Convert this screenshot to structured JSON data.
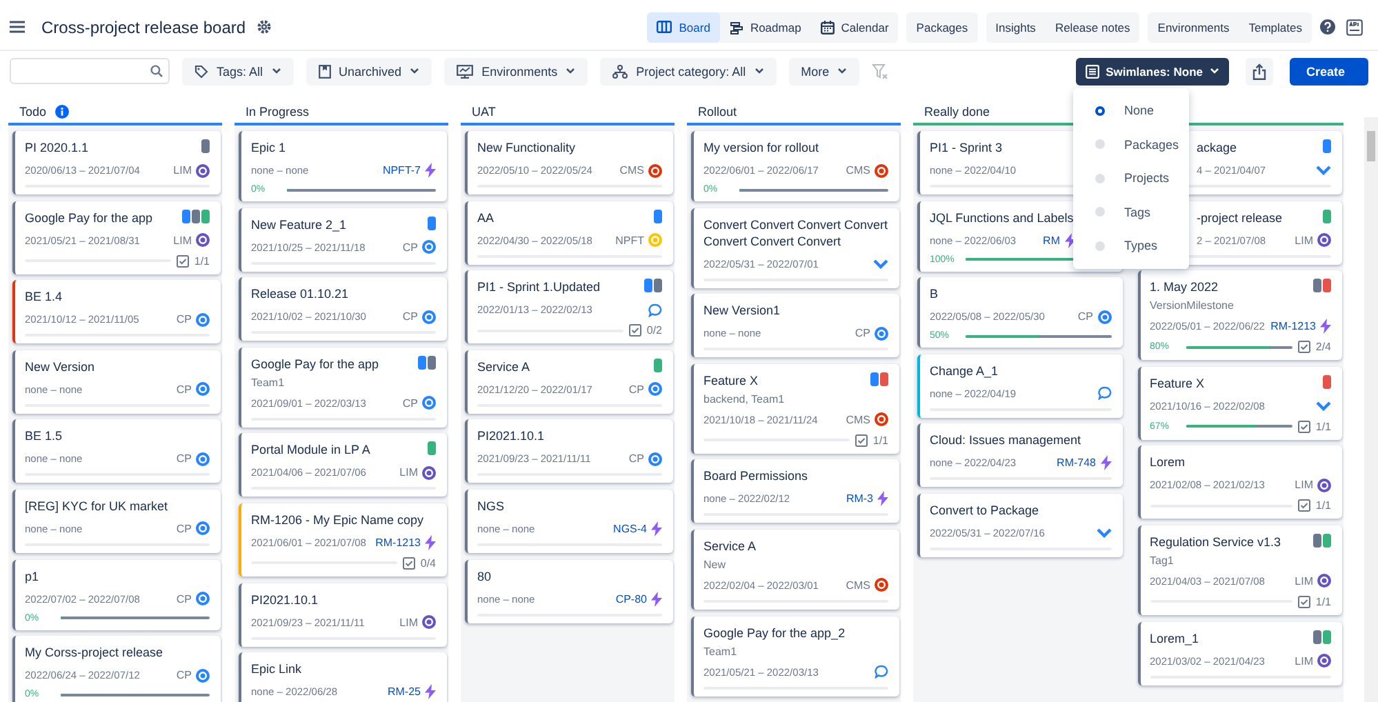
{
  "header": {
    "title": "Cross-project release board"
  },
  "nav_groups": [
    {
      "items": [
        {
          "label": "Board",
          "selected": true
        },
        {
          "label": "Roadmap",
          "selected": false
        },
        {
          "label": "Calendar",
          "selected": false
        }
      ]
    },
    {
      "items": [
        {
          "label": "Packages",
          "selected": false
        }
      ]
    },
    {
      "items": [
        {
          "label": "Insights",
          "selected": false
        },
        {
          "label": "Release notes",
          "selected": false
        }
      ]
    },
    {
      "items": [
        {
          "label": "Environments",
          "selected": false
        },
        {
          "label": "Templates",
          "selected": false
        }
      ]
    }
  ],
  "filters": [
    {
      "label": "Tags: All"
    },
    {
      "label": "Unarchived"
    },
    {
      "label": "Environments"
    },
    {
      "label": "Project category: All"
    },
    {
      "label": "More"
    }
  ],
  "swimlanes": {
    "label": "Swimlanes: None",
    "options": [
      {
        "label": "None",
        "selected": true
      },
      {
        "label": "Packages",
        "selected": false
      },
      {
        "label": "Projects",
        "selected": false
      },
      {
        "label": "Tags",
        "selected": false
      },
      {
        "label": "Types",
        "selected": false
      }
    ]
  },
  "create_button": "Create",
  "columns": [
    {
      "name": "Todo",
      "info": true,
      "color": "#2684ff",
      "lanes": [
        [
          {
            "title": "PI 2020.1.1",
            "tags": [
              {
                "color": "#6b778c"
              }
            ],
            "dates": "2020/06/13 – 2021/07/04",
            "badge": {
              "kind": "project",
              "text": "LIM",
              "color": "#6554c0"
            },
            "color": "#6b778c"
          },
          {
            "title": "Google Pay for the app",
            "tags": [
              {
                "color": "#2684ff"
              },
              {
                "color": "#6b778c"
              },
              {
                "color": "#36b37e"
              }
            ],
            "dates": "2021/05/21 – 2021/08/31",
            "badge": {
              "kind": "project",
              "text": "LIM",
              "color": "#6554c0"
            },
            "checklist": "1/1",
            "color": "#6b778c"
          },
          {
            "title": "BE 1.4",
            "dates": "2021/10/12 – 2021/11/05",
            "badge": {
              "kind": "project",
              "text": "CP",
              "color": "#2684ff"
            },
            "color": "#de350b"
          },
          {
            "title": "New Version",
            "dates": "none – none",
            "badge": {
              "kind": "project",
              "text": "CP",
              "color": "#2684ff"
            },
            "color": "#6b778c"
          },
          {
            "title": "BE 1.5",
            "dates": "none – none",
            "badge": {
              "kind": "project",
              "text": "CP",
              "color": "#2684ff"
            },
            "color": "#6b778c"
          },
          {
            "title": "[REG] KYC for UK market",
            "dates": "none – none",
            "badge": {
              "kind": "project",
              "text": "CP",
              "color": "#2684ff"
            },
            "color": "#6b778c"
          },
          {
            "title": "p1",
            "dates": "2022/07/02 – 2022/07/08",
            "badge": {
              "kind": "project",
              "text": "CP",
              "color": "#2684ff"
            },
            "progress": {
              "label": "0%",
              "level": 0
            },
            "color": "#6b778c"
          },
          {
            "title": "My Corss-project release",
            "dates": "2022/06/24 – 2022/07/12",
            "badge": {
              "kind": "project",
              "text": "CP",
              "color": "#2684ff"
            },
            "progress": {
              "label": "0%",
              "level": 0
            },
            "color": "#6b778c"
          }
        ]
      ]
    },
    {
      "name": "In Progress",
      "info": false,
      "color": "#2684ff",
      "lanes": [
        [
          {
            "title": "Epic 1",
            "dates": "none – none",
            "badge": {
              "kind": "issue",
              "text": "NPFT-7"
            },
            "progress": {
              "label": "0%",
              "level": 0
            },
            "color": "#6b778c"
          },
          {
            "title": "New Feature 2_1",
            "tags": [
              {
                "color": "#2684ff"
              }
            ],
            "dates": "2021/10/25 – 2021/11/18",
            "badge": {
              "kind": "project",
              "text": "CP",
              "color": "#2684ff"
            },
            "color": "#6b778c"
          },
          {
            "title": "Release 01.10.21",
            "dates": "2021/10/02 – 2021/10/30",
            "badge": {
              "kind": "project",
              "text": "CP",
              "color": "#2684ff"
            },
            "color": "#6b778c"
          },
          {
            "title": "Google Pay for the app",
            "tags": [
              {
                "color": "#2684ff"
              },
              {
                "color": "#6b778c"
              }
            ],
            "subtitle": "Team1",
            "dates": "2021/09/01 – 2022/03/13",
            "badge": {
              "kind": "project",
              "text": "CP",
              "color": "#2684ff"
            },
            "color": "#6b778c"
          },
          {
            "title": "Portal Module in LP A",
            "tags": [
              {
                "color": "#36b37e"
              }
            ],
            "dates": "2021/04/06 – 2021/07/06",
            "badge": {
              "kind": "project",
              "text": "LIM",
              "color": "#6554c0"
            },
            "color": "#6b778c"
          },
          {
            "title": "RM-1206 - My Epic Name copy",
            "dates": "2021/06/01 – 2021/07/08",
            "badge": {
              "kind": "issue",
              "text": "RM-1213"
            },
            "checklist": "0/4",
            "color": "#ffab00"
          },
          {
            "title": "PI2021.10.1",
            "dates": "2021/09/23 – 2021/11/11",
            "badge": {
              "kind": "project",
              "text": "LIM",
              "color": "#6554c0"
            },
            "color": "#6b778c"
          },
          {
            "title": "Epic Link",
            "dates": "none – 2022/06/28",
            "badge": {
              "kind": "issue",
              "text": "RM-25"
            },
            "color": "#6b778c"
          }
        ]
      ]
    },
    {
      "name": "UAT",
      "info": false,
      "color": "#2684ff",
      "lanes": [
        [
          {
            "title": "New Functionality",
            "dates": "2022/05/10 – 2022/05/24",
            "badge": {
              "kind": "project",
              "text": "CMS",
              "color": "#de350b"
            },
            "color": "#6b778c"
          },
          {
            "title": "AA",
            "tags": [
              {
                "color": "#2684ff"
              }
            ],
            "dates": "2022/04/30 – 2022/05/18",
            "badge": {
              "kind": "project",
              "text": "NPFT",
              "color": "#ffc400"
            },
            "color": "#6b778c"
          },
          {
            "title": "PI1 - Sprint 1.Updated",
            "tags": [
              {
                "color": "#2684ff"
              },
              {
                "color": "#6b778c"
              }
            ],
            "dates": "2022/01/13 – 2022/02/13",
            "badge": {
              "kind": "chat"
            },
            "checklist": "0/2",
            "color": "#6b778c"
          },
          {
            "title": "Service A",
            "tags": [
              {
                "color": "#36b37e"
              }
            ],
            "dates": "2021/12/20 – 2022/01/17",
            "badge": {
              "kind": "project",
              "text": "CP",
              "color": "#2684ff"
            },
            "color": "#6b778c"
          },
          {
            "title": "PI2021.10.1",
            "dates": "2021/09/23 – 2021/11/11",
            "badge": {
              "kind": "project",
              "text": "CP",
              "color": "#2684ff"
            },
            "color": "#6b778c"
          },
          {
            "title": "NGS",
            "dates": "none – none",
            "badge": {
              "kind": "issue",
              "text": "NGS-4"
            },
            "color": "#6b778c"
          },
          {
            "title": "80",
            "dates": "none – none",
            "badge": {
              "kind": "issue",
              "text": "CP-80"
            },
            "color": "#6b778c"
          }
        ]
      ]
    },
    {
      "name": "Rollout",
      "info": false,
      "color": "#2684ff",
      "lanes": [
        [
          {
            "title": "My version for rollout",
            "dates": "2022/06/01 – 2022/06/17",
            "badge": {
              "kind": "project",
              "text": "CMS",
              "color": "#de350b"
            },
            "progress": {
              "label": "0%",
              "level": 0
            },
            "color": "#6b778c"
          },
          {
            "title": "Convert Convert Convert Convert Convert Convert Convert",
            "dates": "2022/05/31 – 2022/07/01",
            "badge": {
              "kind": "chevron"
            },
            "color": "#6b778c"
          },
          {
            "title": "New Version1",
            "dates": "none – none",
            "badge": {
              "kind": "project",
              "text": "CP",
              "color": "#2684ff"
            },
            "color": "#6b778c"
          },
          {
            "title": "Feature X",
            "tags": [
              {
                "color": "#2684ff"
              },
              {
                "color": "#e5534b"
              }
            ],
            "subtitle": "backend, Team1",
            "dates": "2021/10/18 – 2021/11/24",
            "badge": {
              "kind": "project",
              "text": "CMS",
              "color": "#de350b"
            },
            "checklist": "1/1",
            "color": "#6b778c"
          },
          {
            "title": "Board Permissions",
            "dates": "none – 2022/02/12",
            "badge": {
              "kind": "issue",
              "text": "RM-3"
            },
            "color": "#6b778c"
          },
          {
            "title": "Service A",
            "subtitle": "New",
            "dates": "2022/02/04 – 2022/03/01",
            "badge": {
              "kind": "project",
              "text": "CMS",
              "color": "#de350b"
            },
            "color": "#6b778c"
          },
          {
            "title": "Google Pay for the app_2",
            "subtitle": "Team1",
            "dates": "2021/05/21 – 2022/03/13",
            "badge": {
              "kind": "chat"
            },
            "color": "#6b778c"
          }
        ]
      ]
    },
    {
      "name": "Really done",
      "info": false,
      "color": "#36b37e",
      "lanes": [
        [
          {
            "title": "PI1 - Sprint 3",
            "dates": "none – 2022/04/10",
            "color": "#6b778c"
          },
          {
            "kind": "covered_right",
            "title": "JQL Functions and Labels",
            "dates": "none – 2022/06/03",
            "badge": {
              "kind": "issue",
              "text": "RM"
            },
            "progress": {
              "label": "100%",
              "level": 1
            },
            "color": "#6b778c"
          },
          {
            "title": "B",
            "dates": "2022/05/08 – 2022/05/30",
            "badge": {
              "kind": "project",
              "text": "CP",
              "color": "#2684ff"
            },
            "progress": {
              "label": "50%",
              "level": 0.5
            },
            "color": "#6b778c"
          },
          {
            "title": "Change A_1",
            "dates": "none – 2022/04/19",
            "badge": {
              "kind": "chat"
            },
            "color": "#00b8d9"
          },
          {
            "title": "Cloud: Issues management",
            "dates": "none – 2022/04/23",
            "badge": {
              "kind": "issue",
              "text": "RM-748"
            },
            "color": "#6b778c"
          },
          {
            "title": "Convert to Package",
            "dates": "2022/05/31 – 2022/07/16",
            "badge": {
              "kind": "chevron"
            },
            "color": "#6b778c"
          }
        ],
        [
          {
            "kind": "covered",
            "title": "ackage",
            "tags": [
              {
                "color": "#2684ff"
              }
            ],
            "dates": "4 – 2021/04/07",
            "badge": {
              "kind": "chevron"
            },
            "color": "#6b778c"
          },
          {
            "kind": "covered",
            "title": "-project release",
            "tags": [
              {
                "color": "#36b37e"
              }
            ],
            "dates": "2 – 2021/07/08",
            "badge": {
              "kind": "project",
              "text": "LIM",
              "color": "#6554c0"
            },
            "color": "#6b778c"
          },
          {
            "title": "1. May 2022",
            "tags": [
              {
                "color": "#6b778c"
              },
              {
                "color": "#e5534b"
              }
            ],
            "subtitle": "VersionMilestone",
            "dates": "2022/05/01 – 2022/06/22",
            "badge": {
              "kind": "issue",
              "text": "RM-1213"
            },
            "progress": {
              "label": "80%",
              "level": 0.8
            },
            "checklist": "2/4",
            "color": "#6b778c"
          },
          {
            "title": "Feature X",
            "tags": [
              {
                "color": "#e5534b"
              }
            ],
            "dates": "2021/10/16 – 2022/02/08",
            "badge": {
              "kind": "chevron"
            },
            "progress": {
              "label": "67%",
              "level": 0.67
            },
            "checklist": "1/1",
            "color": "#6b778c"
          },
          {
            "title": "Lorem",
            "dates": "2021/02/08 – 2021/02/13",
            "badge": {
              "kind": "project",
              "text": "LIM",
              "color": "#6554c0"
            },
            "checklist": "1/1",
            "color": "#6b778c"
          },
          {
            "title": "Regulation Service v1.3",
            "tags": [
              {
                "color": "#6b778c"
              },
              {
                "color": "#36b37e"
              }
            ],
            "subtitle": "Tag1",
            "dates": "2021/04/03 – 2021/07/08",
            "badge": {
              "kind": "project",
              "text": "LIM",
              "color": "#6554c0"
            },
            "checklist": "1/1",
            "color": "#6b778c"
          },
          {
            "title": "Lorem_1",
            "tags": [
              {
                "color": "#6b778c"
              },
              {
                "color": "#36b37e"
              }
            ],
            "dates": "2021/03/02 – 2021/04/23",
            "badge": {
              "kind": "project",
              "text": "LIM",
              "color": "#6554c0"
            },
            "color": "#6b778c"
          }
        ]
      ]
    }
  ]
}
